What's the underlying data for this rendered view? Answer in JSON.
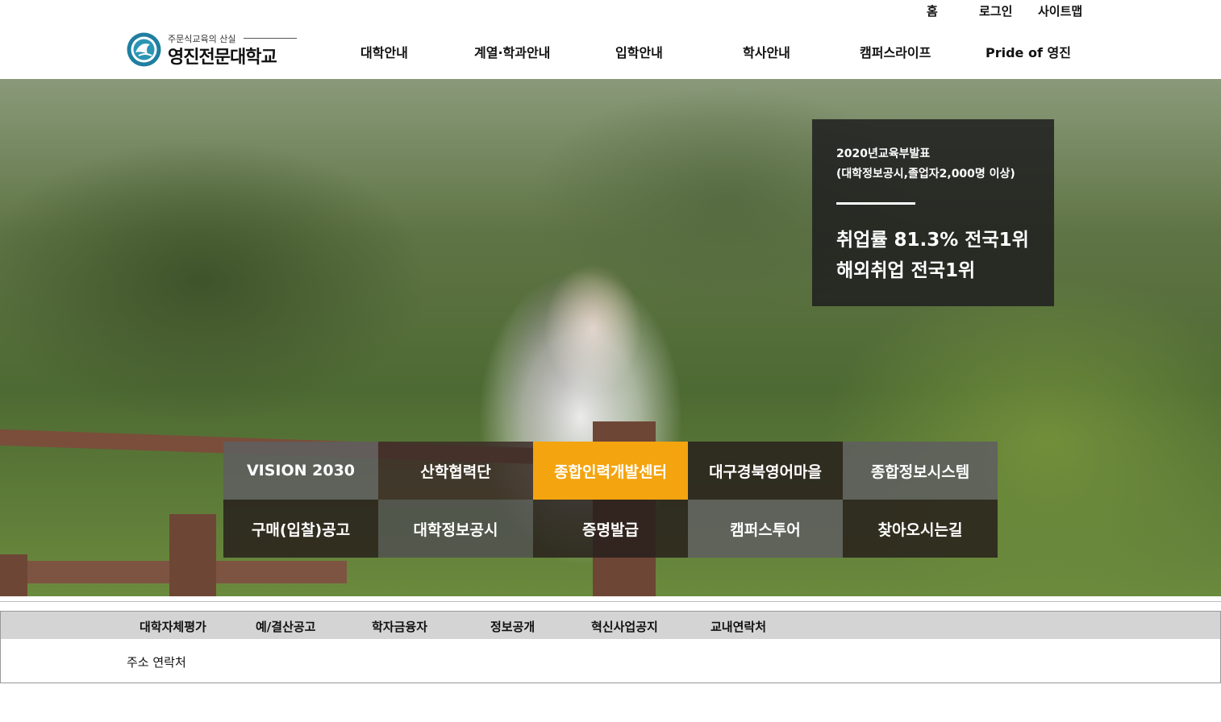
{
  "util_links": {
    "home": "홈",
    "login": "로그인",
    "sitemap": "사이트맵"
  },
  "logo": {
    "tagline": "주문식교육의 산실",
    "name": "영진전문대학교"
  },
  "gnb": [
    "대학안내",
    "계열·학과안내",
    "입학안내",
    "학사안내",
    "캠퍼스라이프",
    "Pride of 영진"
  ],
  "hero": {
    "info": {
      "line1": "2020년교육부발표",
      "line2": "(대학정보공시,졸업자2,000명 이상)",
      "big1": "취업률 81.3% 전국1위",
      "big2": "해외취업 전국1위"
    }
  },
  "quick_menu": [
    {
      "label": "VISION 2030",
      "color": "#5f5f5f"
    },
    {
      "label": "산학협력단",
      "color": "#3c2d28"
    },
    {
      "label": "종합인력개발센터",
      "color": "#f4a40e"
    },
    {
      "label": "대구경북영어마을",
      "color": "#3c2d28"
    },
    {
      "label": "종합정보시스템",
      "color": "#5f5f5f"
    },
    {
      "label": "구매(입찰)공고",
      "color": "#3c2d28"
    },
    {
      "label": "대학정보공시",
      "color": "#505050"
    },
    {
      "label": "증명발급",
      "color": "#3c2d28"
    },
    {
      "label": "캠퍼스투어",
      "color": "#5f5f5f"
    },
    {
      "label": "찾아오시는길",
      "color": "#3c2d28"
    }
  ],
  "footer": {
    "nav": [
      "대학자체평가",
      "예/결산공고",
      "학자금융자",
      "정보공개",
      "혁신사업공지",
      "교내연락처"
    ],
    "address": "주소 연락처"
  }
}
